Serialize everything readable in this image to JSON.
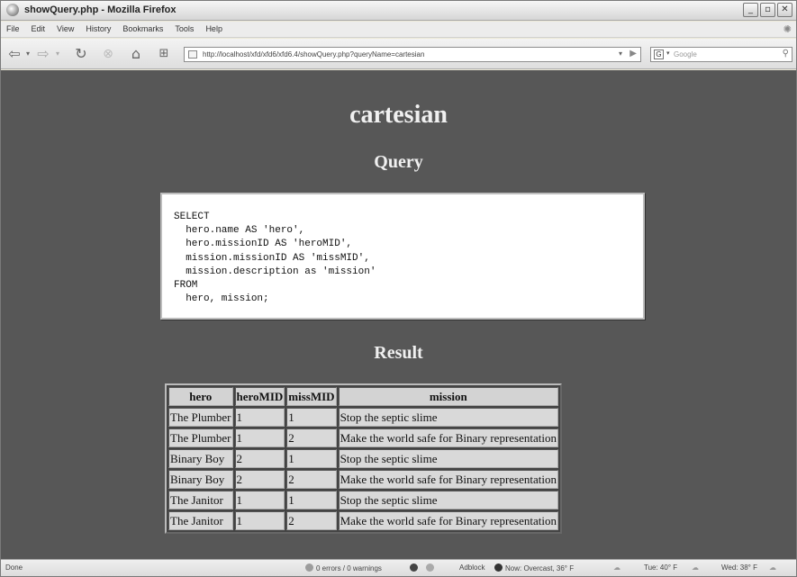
{
  "window": {
    "title": "showQuery.php - Mozilla Firefox"
  },
  "menu": [
    "File",
    "Edit",
    "View",
    "History",
    "Bookmarks",
    "Tools",
    "Help"
  ],
  "nav": {
    "url": "http://localhost/xfd/xfd6/xfd6.4/showQuery.php?queryName=cartesian",
    "search_placeholder": "Google",
    "search_engine": "G"
  },
  "page": {
    "heading": "cartesian",
    "query_heading": "Query",
    "query_text": "SELECT\n  hero.name AS 'hero',\n  hero.missionID AS 'heroMID',\n  mission.missionID AS 'missMID',\n  mission.description as 'mission'\nFROM\n  hero, mission;",
    "result_heading": "Result",
    "table": {
      "columns": [
        "hero",
        "heroMID",
        "missMID",
        "mission"
      ],
      "rows": [
        [
          "The Plumber",
          "1",
          "1",
          "Stop the septic slime"
        ],
        [
          "The Plumber",
          "1",
          "2",
          "Make the world safe for Binary representation"
        ],
        [
          "Binary Boy",
          "2",
          "1",
          "Stop the septic slime"
        ],
        [
          "Binary Boy",
          "2",
          "2",
          "Make the world safe for Binary representation"
        ],
        [
          "The Janitor",
          "1",
          "1",
          "Stop the septic slime"
        ],
        [
          "The Janitor",
          "1",
          "2",
          "Make the world safe for Binary representation"
        ]
      ]
    }
  },
  "status": {
    "done": "Done",
    "errors": "0 errors / 0 warnings",
    "adblock": "Adblock",
    "weather_now": "Now: Overcast, 36° F",
    "weather_tue": "Tue: 40° F",
    "weather_wed": "Wed: 38° F"
  }
}
